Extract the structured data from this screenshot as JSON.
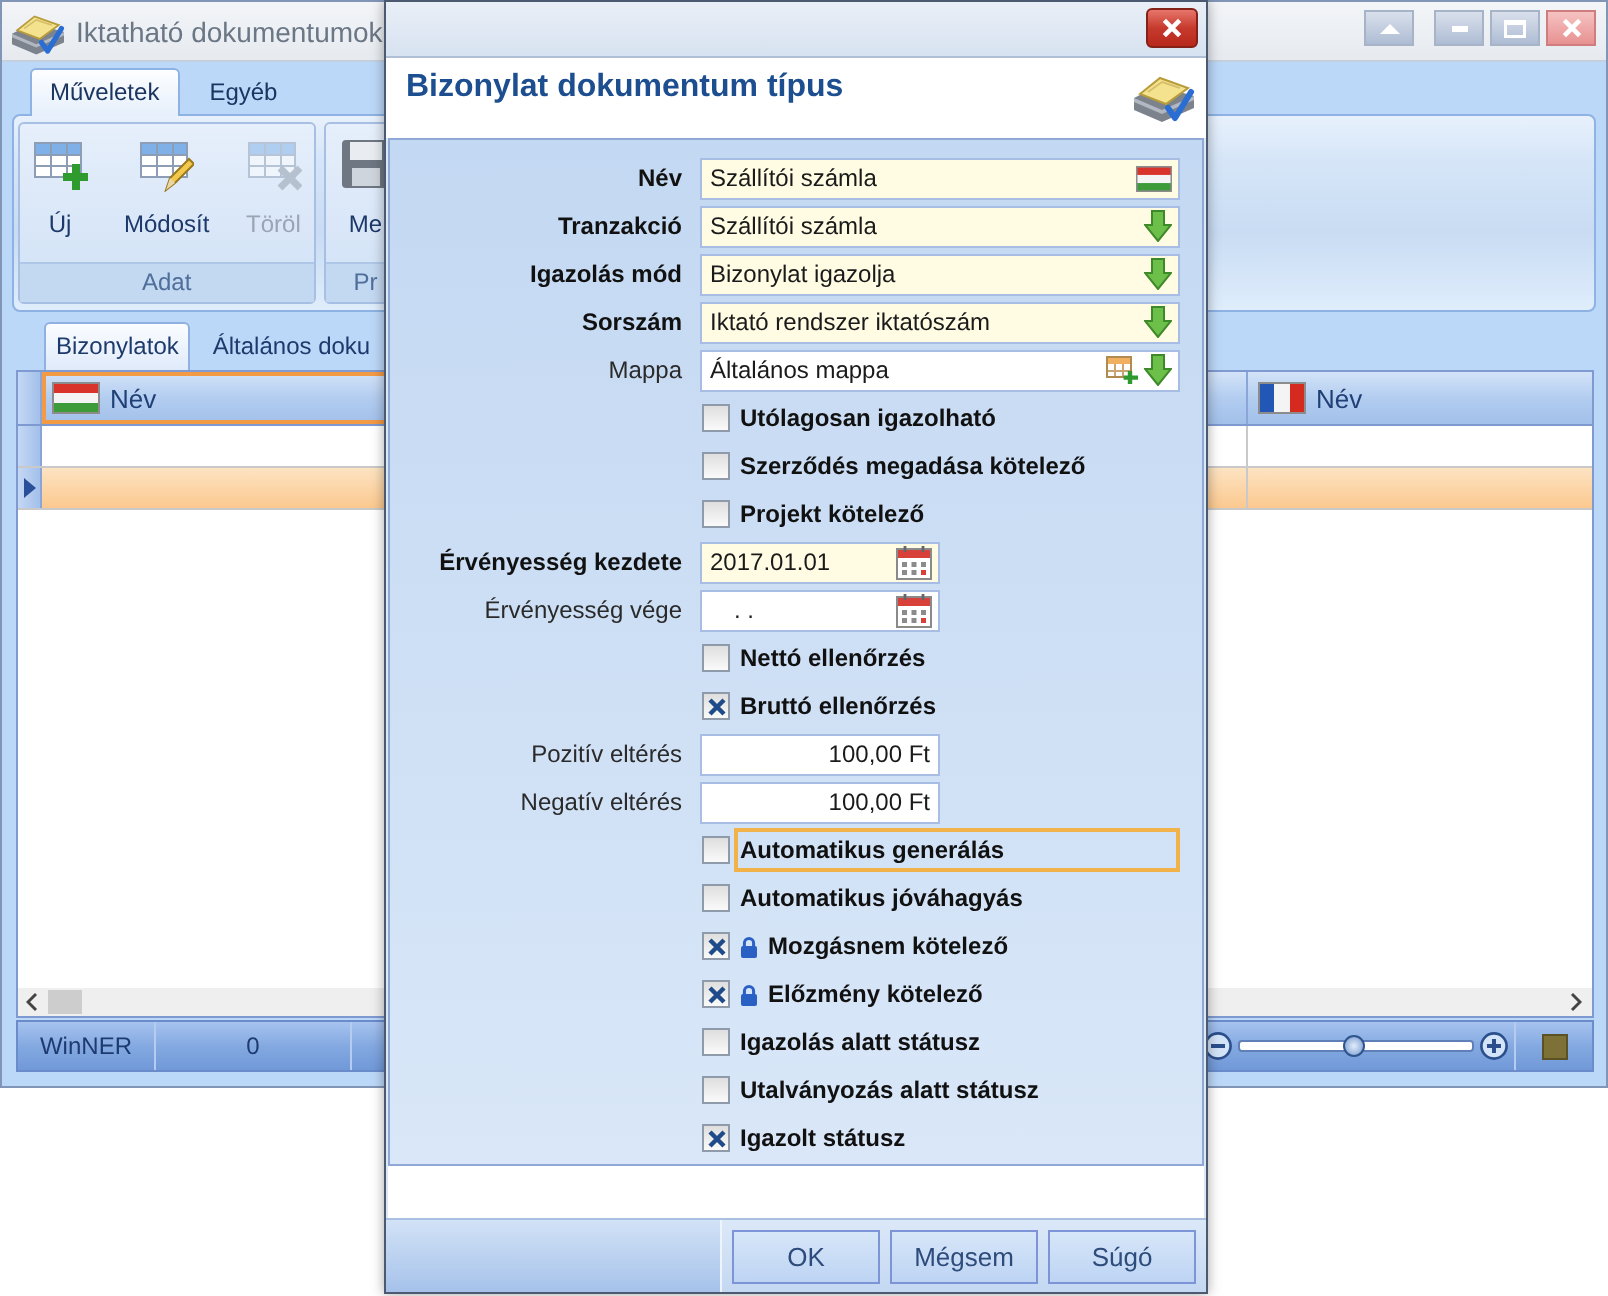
{
  "window": {
    "title": "Iktatható dokumentumok"
  },
  "ribbon": {
    "tabs": [
      {
        "label": "Műveletek",
        "selected": true
      },
      {
        "label": "Egyéb",
        "selected": false
      }
    ],
    "groups": [
      {
        "label": "Adat",
        "buttons": [
          {
            "kind": "new",
            "label": "Új",
            "disabled": false
          },
          {
            "kind": "edit",
            "label": "Módosít",
            "disabled": false
          },
          {
            "kind": "delete",
            "label": "Töröl",
            "disabled": true
          }
        ]
      },
      {
        "label": "Pr",
        "buttons": [
          {
            "kind": "save",
            "label": "Me",
            "disabled": false
          }
        ]
      }
    ]
  },
  "content_tabs": [
    {
      "label": "Bizonylatok",
      "selected": true
    },
    {
      "label": "Általános doku",
      "selected": false
    }
  ],
  "grid": {
    "columns": [
      {
        "label": "Név",
        "kind": "hungarian",
        "selected": true
      },
      {
        "label": "Név",
        "kind": "french",
        "selected": false
      }
    ],
    "rows": [
      {
        "selected": false
      },
      {
        "selected": true
      }
    ]
  },
  "status_bar": {
    "panels": [
      "WinNER",
      "0"
    ],
    "zoom": {
      "level": 0.49
    }
  },
  "dialog": {
    "title": "Bizonylat dokumentum típus",
    "fields": [
      {
        "kind": "translated",
        "label": "Név",
        "required": true,
        "value": "Szállítói számla"
      },
      {
        "kind": "lookup",
        "label": "Tranzakció",
        "required": true,
        "value": "Szállítói számla"
      },
      {
        "kind": "lookup",
        "label": "Igazolás mód",
        "required": true,
        "value": "Bizonylat igazolja"
      },
      {
        "kind": "lookup",
        "label": "Sorszám",
        "required": true,
        "value": "Iktató rendszer iktatószám"
      },
      {
        "kind": "folder",
        "label": "Mappa",
        "required": false,
        "value": "Általános mappa"
      },
      {
        "kind": "checkbox",
        "label": "Utólagosan igazolható",
        "checked": false,
        "locked": false,
        "focused": false
      },
      {
        "kind": "checkbox",
        "label": "Szerződés megadása kötelező",
        "checked": false,
        "locked": false,
        "focused": false
      },
      {
        "kind": "checkbox",
        "label": "Projekt kötelező",
        "checked": false,
        "locked": false,
        "focused": false
      },
      {
        "kind": "date",
        "label": "Érvényesség kezdete",
        "required": true,
        "value": "2017.01.01"
      },
      {
        "kind": "date",
        "label": "Érvényesség vége",
        "required": false,
        "placeholder": ". ."
      },
      {
        "kind": "checkbox",
        "label": "Nettó ellenőrzés",
        "checked": false,
        "locked": false,
        "focused": false
      },
      {
        "kind": "checkbox",
        "label": "Bruttó ellenőrzés",
        "checked": true,
        "locked": false,
        "focused": false
      },
      {
        "kind": "amount",
        "label": "Pozitív eltérés",
        "required": false,
        "value": "100,00 Ft"
      },
      {
        "kind": "amount",
        "label": "Negatív eltérés",
        "required": false,
        "value": "100,00 Ft"
      },
      {
        "kind": "checkbox",
        "label": "Automatikus generálás",
        "checked": false,
        "locked": false,
        "focused": true
      },
      {
        "kind": "checkbox",
        "label": "Automatikus jóváhagyás",
        "checked": false,
        "locked": false,
        "focused": false
      },
      {
        "kind": "checkbox",
        "label": "Mozgásnem kötelező",
        "checked": true,
        "locked": true,
        "focused": false
      },
      {
        "kind": "checkbox",
        "label": "Előzmény kötelező",
        "checked": true,
        "locked": true,
        "focused": false
      },
      {
        "kind": "checkbox",
        "label": "Igazolás alatt státusz",
        "checked": false,
        "locked": false,
        "focused": false
      },
      {
        "kind": "checkbox",
        "label": "Utalványozás alatt státusz",
        "checked": false,
        "locked": false,
        "focused": false
      },
      {
        "kind": "checkbox",
        "label": "Igazolt státusz",
        "checked": true,
        "locked": false,
        "focused": false
      }
    ],
    "buttons": [
      "OK",
      "Mégsem",
      "Súgó"
    ]
  }
}
